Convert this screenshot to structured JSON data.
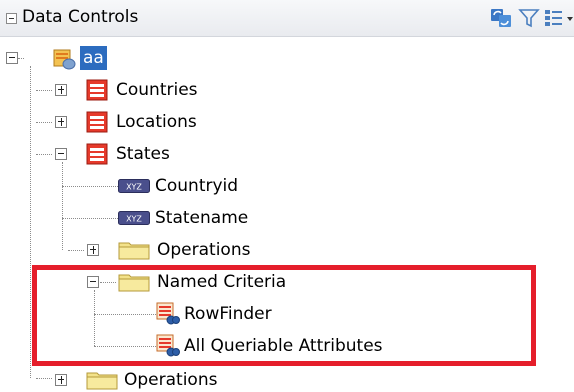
{
  "panel": {
    "title": "Data Controls",
    "toolbar": [
      "refresh-icon",
      "filter-icon",
      "view-options-icon"
    ]
  },
  "tree": {
    "root": {
      "label": "aa"
    },
    "countries": {
      "label": "Countries"
    },
    "locations": {
      "label": "Locations"
    },
    "states": {
      "label": "States",
      "countryid": "Countryid",
      "statename": "Statename",
      "operations": "Operations",
      "named_criteria": {
        "label": "Named Criteria",
        "rowfinder": "RowFinder",
        "all_queriable": "All Queriable Attributes"
      }
    },
    "operations": {
      "label": "Operations"
    }
  },
  "colors": {
    "highlight_box": "#e51e2b",
    "selected_bg": "#2c6cbf"
  }
}
